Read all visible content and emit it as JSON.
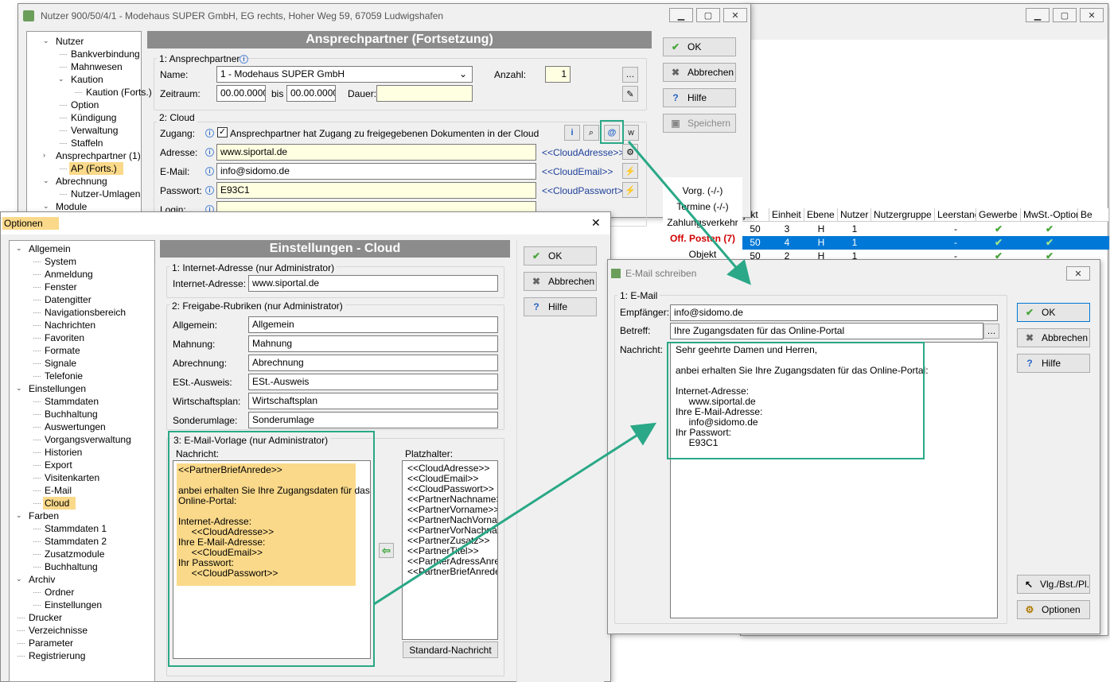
{
  "bg_window": {
    "list_headers": [
      "jekt",
      "Einheit",
      "Ebene",
      "Nutzer",
      "Nutzergruppe",
      "Leerstand",
      "Gewerbe",
      "MwSt.-Option",
      "Be"
    ],
    "rows": [
      [
        "50",
        "3",
        "H",
        "1",
        "",
        "-",
        "✔",
        "✔"
      ],
      [
        "50",
        "4",
        "H",
        "1",
        "",
        "-",
        "✔",
        "✔"
      ],
      [
        "50",
        "2",
        "H",
        "1",
        "",
        "-",
        "✔",
        "✔"
      ]
    ]
  },
  "nutzer_window": {
    "title": "Nutzer 900/50/4/1 - Modehaus SUPER GmbH, EG rechts, Hoher Weg 59, 67059 Ludwigshafen",
    "tree": [
      {
        "label": "Nutzer",
        "lvl": 0,
        "twisty": "v"
      },
      {
        "label": "Bankverbindung",
        "lvl": 1
      },
      {
        "label": "Mahnwesen",
        "lvl": 1
      },
      {
        "label": "Kaution",
        "lvl": 1,
        "twisty": "v"
      },
      {
        "label": "Kaution (Forts.)",
        "lvl": 2
      },
      {
        "label": "Option",
        "lvl": 1
      },
      {
        "label": "Kündigung",
        "lvl": 1
      },
      {
        "label": "Verwaltung",
        "lvl": 1
      },
      {
        "label": "Staffeln",
        "lvl": 1
      },
      {
        "label": "Ansprechpartner (1)",
        "lvl": 0,
        "twisty": ">"
      },
      {
        "label": "AP (Forts.)",
        "lvl": 1,
        "sel": true
      },
      {
        "label": "Abrechnung",
        "lvl": 0,
        "twisty": "v"
      },
      {
        "label": "Nutzer-Umlagen",
        "lvl": 1
      },
      {
        "label": "Module",
        "lvl": 0,
        "twisty": "v"
      }
    ],
    "header": "Ansprechpartner (Fortsetzung)",
    "g1": "1: Ansprechpartner",
    "name_label": "Name:",
    "name_value": "1 - Modehaus SUPER GmbH",
    "anzahl_label": "Anzahl:",
    "anzahl_value": "1",
    "zeitraum_label": "Zeitraum:",
    "from": "00.00.0000",
    "bis": "bis",
    "to": "00.00.0000",
    "dauer_label": "Dauer:",
    "g2": "2: Cloud",
    "zugang_label": "Zugang:",
    "zugang_text": "Ansprechpartner hat Zugang zu freigegebenen Dokumenten in der Cloud",
    "adresse_label": "Adresse:",
    "adresse_value": "www.siportal.de",
    "adresse_ph": "<<CloudAdresse>>",
    "email_label": "E-Mail:",
    "email_value": "info@sidomo.de",
    "email_ph": "<<CloudEmail>>",
    "pw_label": "Passwort:",
    "pw_value": "E93C1",
    "pw_ph": "<<CloudPasswort>>",
    "login_label": "Login:",
    "buttons": {
      "ok": "OK",
      "cancel": "Abbrechen",
      "help": "Hilfe",
      "save": "Speichern"
    },
    "side": [
      "Vorg. (-/-)",
      "Termine (-/-)",
      "Zahlungsverkehr",
      "Off. Posten (7)",
      "Objekt"
    ]
  },
  "optionen": {
    "title": "Optionen",
    "tree": [
      {
        "label": "Allgemein",
        "lvl": 0,
        "twisty": "v"
      },
      {
        "label": "System",
        "lvl": 1
      },
      {
        "label": "Anmeldung",
        "lvl": 1
      },
      {
        "label": "Fenster",
        "lvl": 1
      },
      {
        "label": "Datengitter",
        "lvl": 1
      },
      {
        "label": "Navigationsbereich",
        "lvl": 1
      },
      {
        "label": "Nachrichten",
        "lvl": 1
      },
      {
        "label": "Favoriten",
        "lvl": 1
      },
      {
        "label": "Formate",
        "lvl": 1
      },
      {
        "label": "Signale",
        "lvl": 1
      },
      {
        "label": "Telefonie",
        "lvl": 1
      },
      {
        "label": "Einstellungen",
        "lvl": 0,
        "twisty": "v"
      },
      {
        "label": "Stammdaten",
        "lvl": 1
      },
      {
        "label": "Buchhaltung",
        "lvl": 1
      },
      {
        "label": "Auswertungen",
        "lvl": 1
      },
      {
        "label": "Vorgangsverwaltung",
        "lvl": 1
      },
      {
        "label": "Historien",
        "lvl": 1
      },
      {
        "label": "Export",
        "lvl": 1
      },
      {
        "label": "Visitenkarten",
        "lvl": 1
      },
      {
        "label": "E-Mail",
        "lvl": 1
      },
      {
        "label": "Cloud",
        "lvl": 1,
        "sel": true
      },
      {
        "label": "Farben",
        "lvl": 0,
        "twisty": "v"
      },
      {
        "label": "Stammdaten 1",
        "lvl": 1
      },
      {
        "label": "Stammdaten 2",
        "lvl": 1
      },
      {
        "label": "Zusatzmodule",
        "lvl": 1
      },
      {
        "label": "Buchhaltung",
        "lvl": 1
      },
      {
        "label": "Archiv",
        "lvl": 0,
        "twisty": "v"
      },
      {
        "label": "Ordner",
        "lvl": 1
      },
      {
        "label": "Einstellungen",
        "lvl": 1
      },
      {
        "label": "Drucker",
        "lvl": 0
      },
      {
        "label": "Verzeichnisse",
        "lvl": 0
      },
      {
        "label": "Parameter",
        "lvl": 0
      },
      {
        "label": "Registrierung",
        "lvl": 0
      }
    ],
    "header": "Einstellungen - Cloud",
    "g1": "1: Internet-Adresse  (nur Administrator)",
    "inet_label": "Internet-Adresse:",
    "inet_value": "www.siportal.de",
    "g2": "2: Freigabe-Rubriken  (nur Administrator)",
    "rubriken": [
      [
        "Allgemein:",
        "Allgemein"
      ],
      [
        "Mahnung:",
        "Mahnung"
      ],
      [
        "Abrechnung:",
        "Abrechnung"
      ],
      [
        "ESt.-Ausweis:",
        "ESt.-Ausweis"
      ],
      [
        "Wirtschaftsplan:",
        "Wirtschaftsplan"
      ],
      [
        "Sonderumlage:",
        "Sonderumlage"
      ]
    ],
    "g3": "3: E-Mail-Vorlage  (nur Administrator)",
    "nachricht_label": "Nachricht:",
    "nachricht": "<<PartnerBriefAnrede>>\n\nanbei erhalten Sie Ihre Zugangsdaten für das\nOnline-Portal:\n\nInternet-Adresse:\n     <<CloudAdresse>>\nIhre E-Mail-Adresse:\n     <<CloudEmail>>\nIhr Passwort:\n     <<CloudPasswort>>",
    "platz_label": "Platzhalter:",
    "platzhalter": [
      "<<CloudAdresse>>",
      "<<CloudEmail>>",
      "<<CloudPasswort>>",
      "<<PartnerNachname>>",
      "<<PartnerVorname>>",
      "<<PartnerNachVorname",
      "<<PartnerVorNachname",
      "<<PartnerZusatz>>",
      "<<PartnerTitel>>",
      "<<PartnerAdressAnrede>",
      "<<PartnerBriefAnrede>>"
    ],
    "std_btn": "Standard-Nachricht",
    "buttons": {
      "ok": "OK",
      "cancel": "Abbrechen",
      "help": "Hilfe"
    }
  },
  "email": {
    "title": "E-Mail schreiben",
    "g1": "1: E-Mail",
    "to_label": "Empfänger:",
    "to_value": "info@sidomo.de",
    "subj_label": "Betreff:",
    "subj_value": "Ihre Zugangsdaten für das Online-Portal",
    "msg_label": "Nachricht:",
    "msg": "Sehr geehrte Damen und Herren,\n\nanbei erhalten Sie Ihre Zugangsdaten für das Online-Portal:\n\nInternet-Adresse:\n     www.siportal.de\nIhre E-Mail-Adresse:\n     info@sidomo.de\nIhr Passwort:\n     E93C1",
    "buttons": {
      "ok": "OK",
      "cancel": "Abbrechen",
      "help": "Hilfe",
      "vlg": "Vlg./Bst./Pl.",
      "opt": "Optionen"
    }
  }
}
